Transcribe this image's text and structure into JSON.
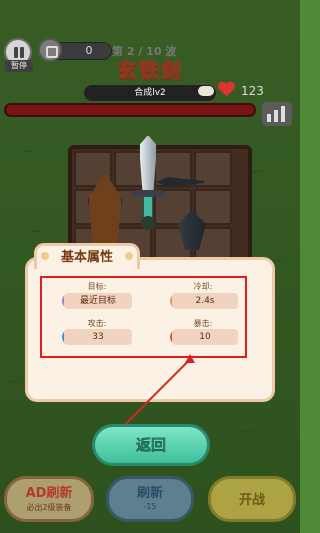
{
  "hud": {
    "pause_label": "暂停",
    "coins": "0",
    "level_text": "第 2 / 10 波",
    "hp": "123"
  },
  "weapon": {
    "name": "玄铁剑",
    "merge_level": "合成lv2"
  },
  "panel": {
    "tab_title": "基本属性",
    "target_label": "目标:",
    "target_value": "最近目标",
    "cooldown_label": "冷却:",
    "cooldown_value": "2.4s",
    "attack_label": "攻击:",
    "attack_value": "33",
    "crit_label": "暴击:",
    "crit_value": "10"
  },
  "buttons": {
    "back": "返回",
    "ad_refresh": "AD刷新",
    "ad_refresh_sub": "必出2级装备",
    "refresh": "刷新",
    "refresh_cost": "-15",
    "start": "开战"
  },
  "colors": {
    "highlight_box": "#e21b1b",
    "back_button": "#4fcfa9"
  }
}
